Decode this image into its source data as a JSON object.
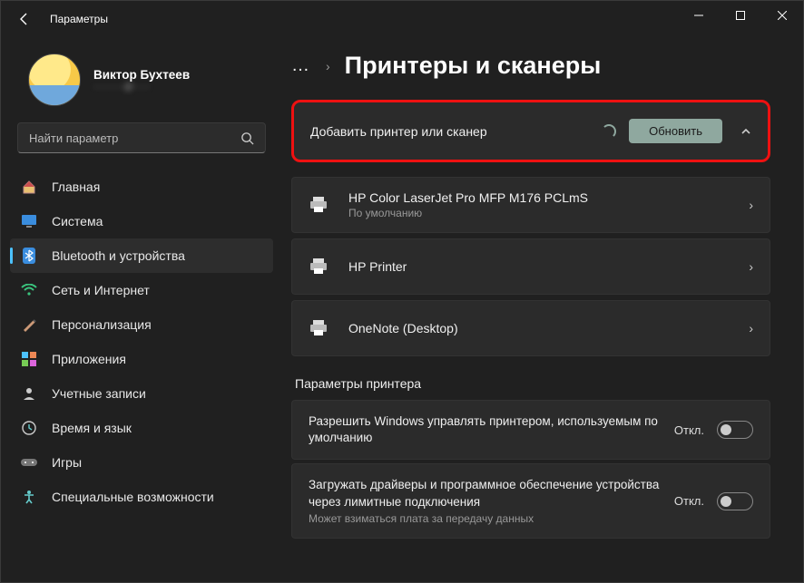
{
  "window": {
    "title": "Параметры"
  },
  "profile": {
    "name": "Виктор Бухтеев",
    "email": "·········@·····"
  },
  "search": {
    "placeholder": "Найти параметр"
  },
  "sidebar": {
    "items": [
      {
        "id": "home",
        "label": "Главная"
      },
      {
        "id": "system",
        "label": "Система"
      },
      {
        "id": "bluetooth",
        "label": "Bluetooth и устройства",
        "active": true
      },
      {
        "id": "network",
        "label": "Сеть и Интернет"
      },
      {
        "id": "personalization",
        "label": "Персонализация"
      },
      {
        "id": "apps",
        "label": "Приложения"
      },
      {
        "id": "accounts",
        "label": "Учетные записи"
      },
      {
        "id": "time",
        "label": "Время и язык"
      },
      {
        "id": "gaming",
        "label": "Игры"
      },
      {
        "id": "accessibility",
        "label": "Специальные возможности"
      }
    ]
  },
  "page": {
    "title": "Принтеры и сканеры",
    "add_label": "Добавить принтер или сканер",
    "refresh_label": "Обновить"
  },
  "printers": [
    {
      "name": "HP Color LaserJet Pro MFP M176 PCLmS",
      "sub": "По умолчанию"
    },
    {
      "name": "HP Printer"
    },
    {
      "name": "OneNote (Desktop)"
    }
  ],
  "settings_section": "Параметры принтера",
  "settings": [
    {
      "title": "Разрешить Windows управлять принтером, используемым по умолчанию",
      "state": "Откл."
    },
    {
      "title": "Загружать драйверы и программное обеспечение устройства через лимитные подключения",
      "sub": "Может взиматься плата за передачу данных",
      "state": "Откл."
    }
  ]
}
